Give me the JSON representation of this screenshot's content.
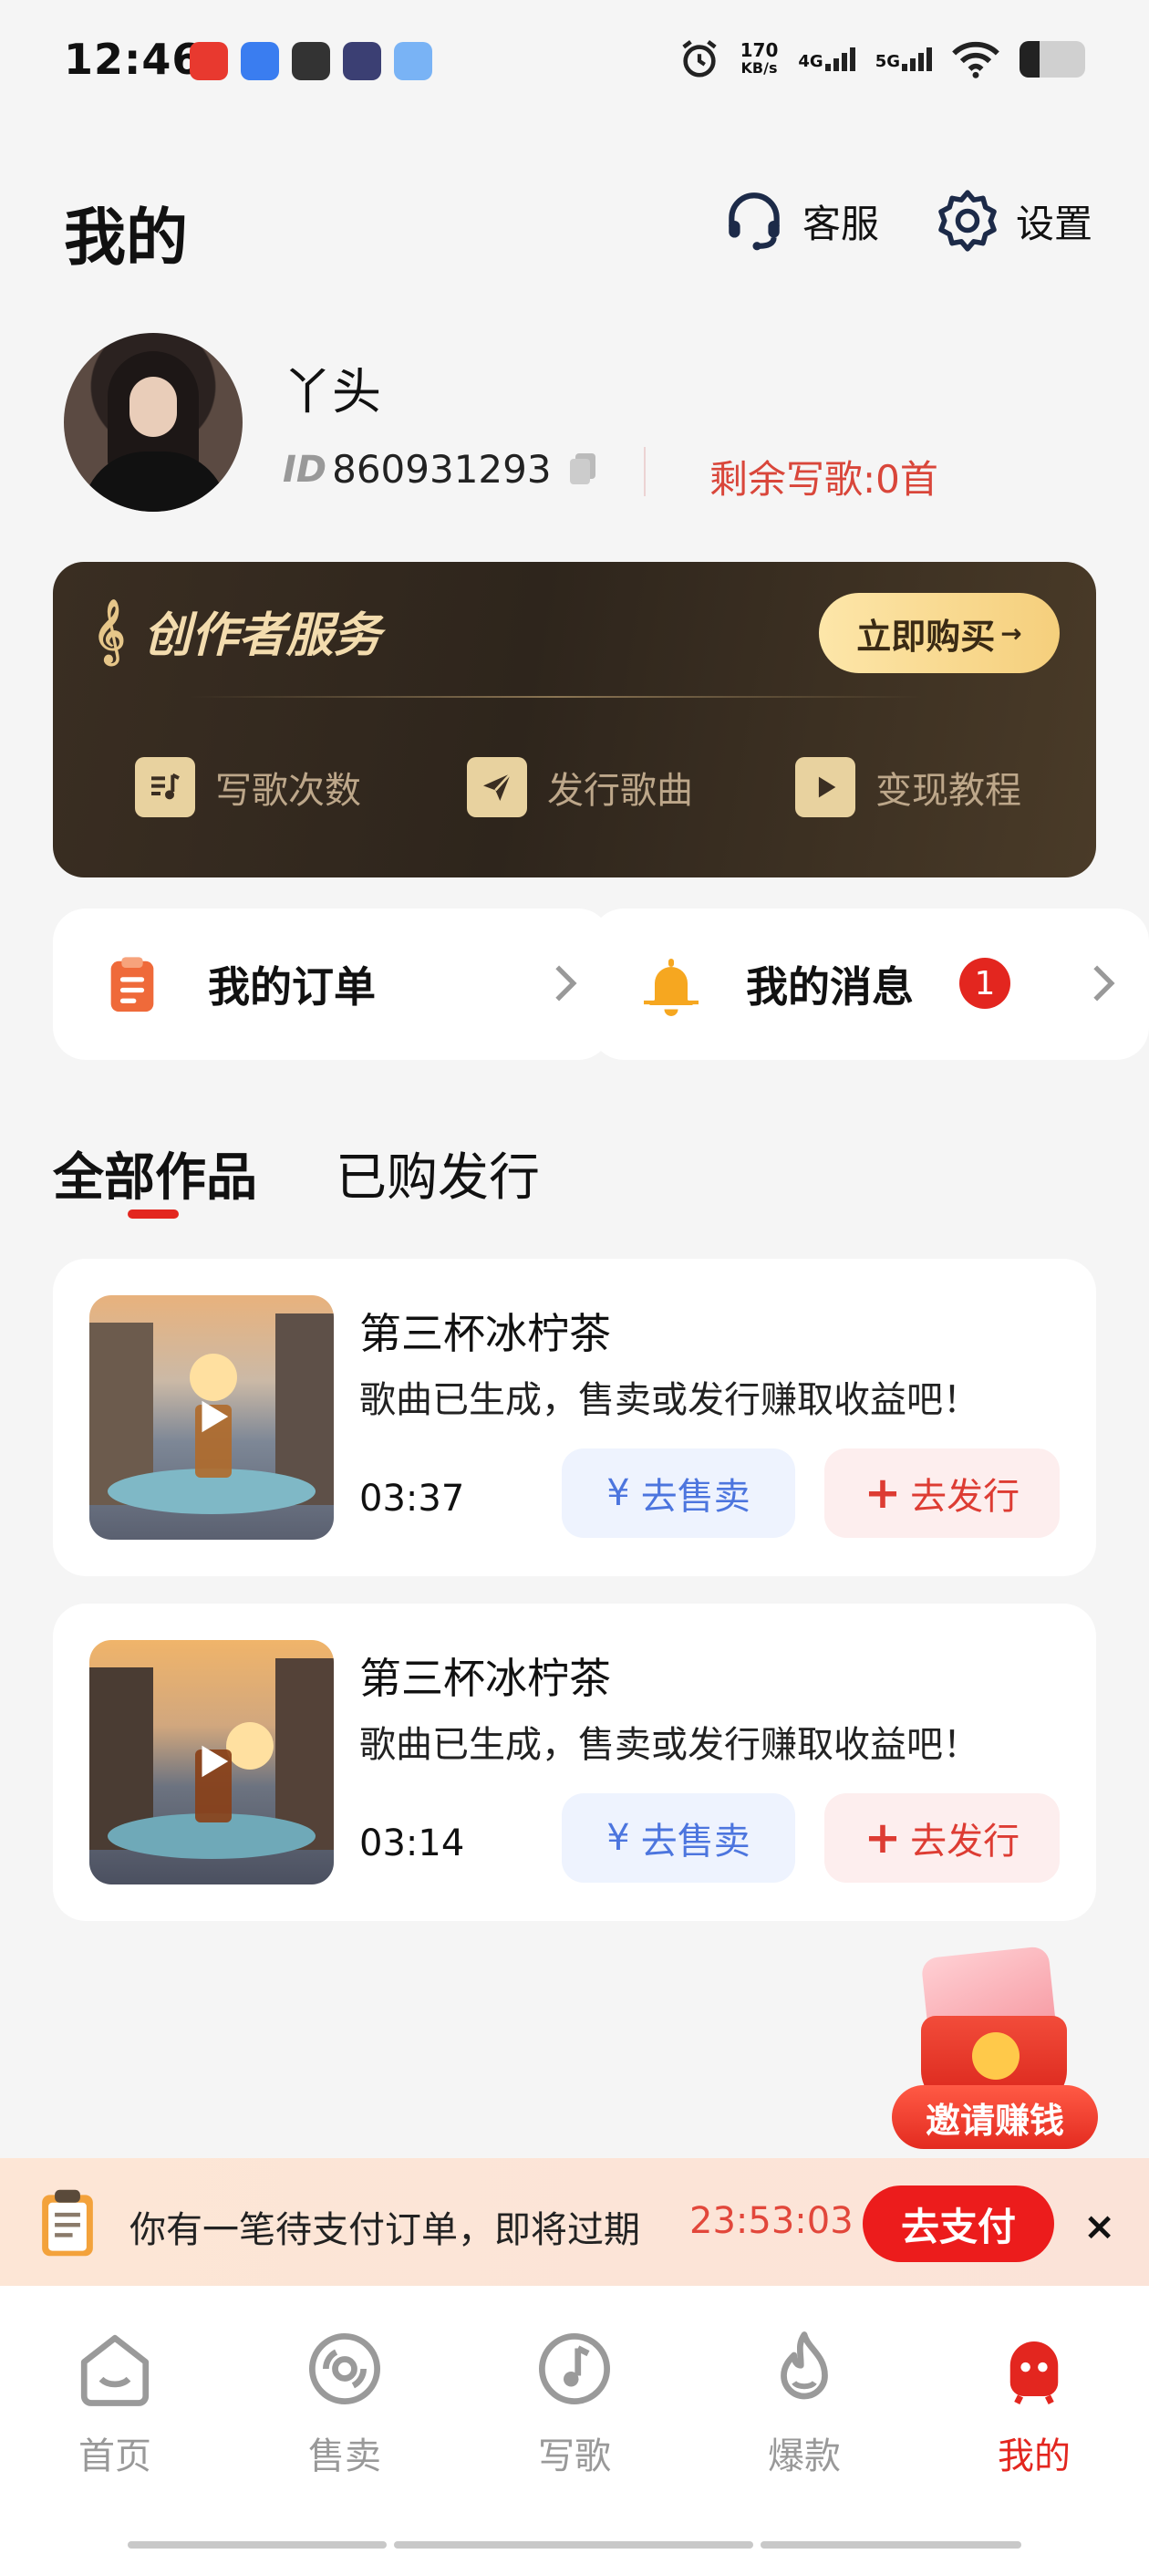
{
  "status": {
    "time": "12:46",
    "speed_value": "170",
    "speed_unit": "KB/s",
    "net1": "4G",
    "net2": "5G",
    "battery_level": 0.3
  },
  "header": {
    "title": "我的",
    "service_label": "客服",
    "settings_label": "设置"
  },
  "profile": {
    "name": "丫头",
    "id_tag": "ID",
    "id_value": "860931293",
    "quota": "剩余写歌:0首"
  },
  "creator": {
    "title": "创作者服务",
    "buy_label": "立即购买",
    "buy_arrow": "→",
    "services": [
      {
        "label": "写歌次数",
        "icon": "music-note-icon"
      },
      {
        "label": "发行歌曲",
        "icon": "send-icon"
      },
      {
        "label": "变现教程",
        "icon": "play-icon"
      }
    ]
  },
  "quick": {
    "orders_label": "我的订单",
    "messages_label": "我的消息",
    "messages_badge": "1"
  },
  "tabs": {
    "all_works": "全部作品",
    "purchased_release": "已购发行"
  },
  "works": [
    {
      "title": "第三杯冰柠茶",
      "subtitle": "歌曲已生成，售卖或发行赚取收益吧！",
      "duration": "03:37",
      "sell_label": "去售卖",
      "release_label": "去发行"
    },
    {
      "title": "第三杯冰柠茶",
      "subtitle": "歌曲已生成，售卖或发行赚取收益吧！",
      "duration": "03:14",
      "sell_label": "去售卖",
      "release_label": "去发行"
    }
  ],
  "symbols": {
    "yuan": "¥",
    "plus": "+"
  },
  "invite": {
    "label": "邀请赚钱"
  },
  "payment": {
    "text": "你有一笔待支付订单，即将过期",
    "timer": "23:53:03",
    "pay_label": "去支付",
    "close": "×"
  },
  "nav": {
    "items": [
      {
        "label": "首页"
      },
      {
        "label": "售卖"
      },
      {
        "label": "写歌"
      },
      {
        "label": "爆款"
      },
      {
        "label": "我的"
      }
    ],
    "active_index": 4
  },
  "colors": {
    "accent": "#e3261f",
    "gold": "#f5cf7c",
    "sell_blue": "#4c75de"
  }
}
